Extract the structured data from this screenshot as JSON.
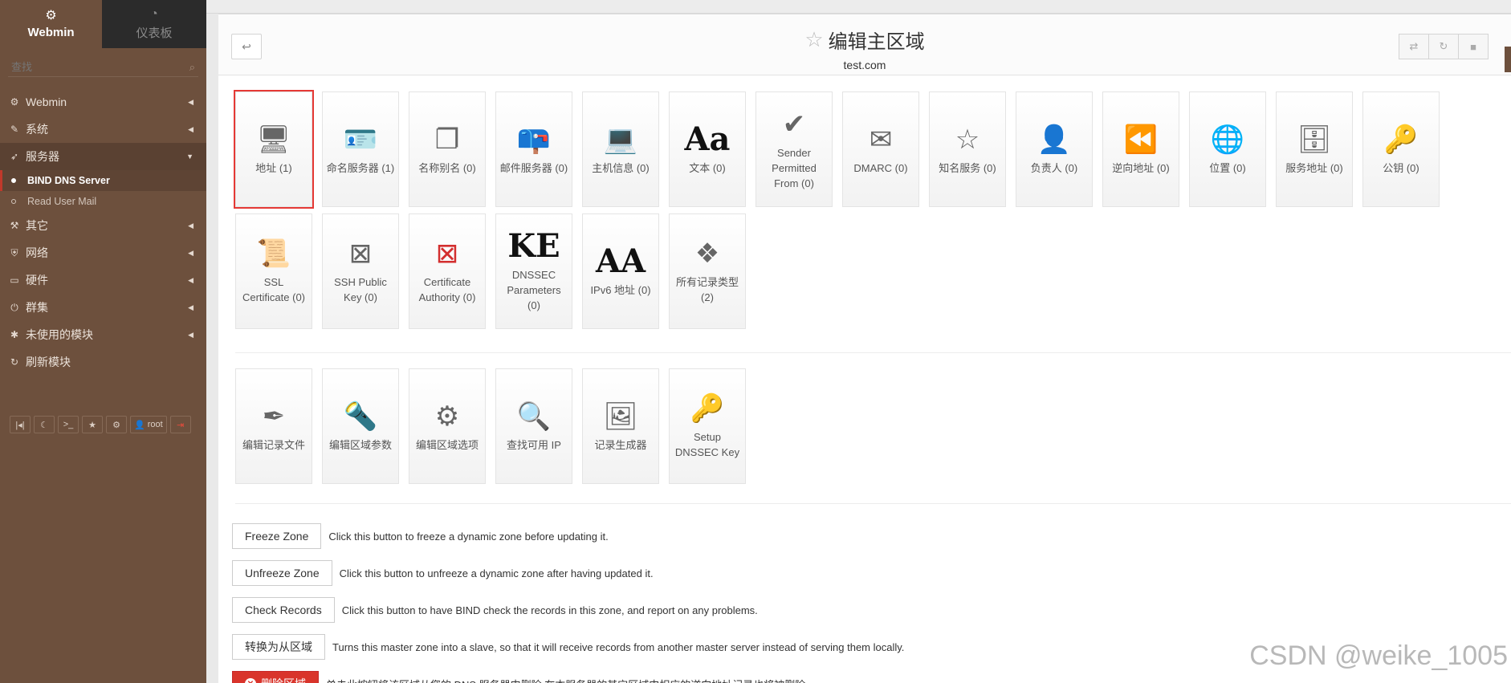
{
  "sidebar": {
    "brand_label": "Webmin",
    "dashboard_label": "仪表板",
    "search_placeholder": "查找",
    "items": [
      {
        "label": "Webmin",
        "icon": "gear-icon"
      },
      {
        "label": "系统",
        "icon": "wrench-icon"
      },
      {
        "label": "服务器",
        "icon": "rocket-icon"
      },
      {
        "label": "其它",
        "icon": "hammer-icon"
      },
      {
        "label": "网络",
        "icon": "shield-icon"
      },
      {
        "label": "硬件",
        "icon": "hdd-icon"
      },
      {
        "label": "群集",
        "icon": "power-icon"
      },
      {
        "label": "未使用的模块",
        "icon": "puzzle-icon"
      },
      {
        "label": "刷新模块",
        "icon": "refresh-icon"
      }
    ],
    "subitems": [
      {
        "label": "BIND DNS Server"
      },
      {
        "label": "Read User Mail"
      }
    ],
    "toolbar_user": "root"
  },
  "header": {
    "title": "编辑主区域",
    "subtitle": "test.com"
  },
  "records": [
    {
      "label": "地址 (1)",
      "icon": "computer-icon"
    },
    {
      "label": "命名服务器 (1)",
      "icon": "nameserver-card-icon"
    },
    {
      "label": "名称别名 (0)",
      "icon": "alias-windows-icon"
    },
    {
      "label": "邮件服务器 (0)",
      "icon": "mailbox-icon"
    },
    {
      "label": "主机信息 (0)",
      "icon": "laptop-icon"
    },
    {
      "label": "文本 (0)",
      "icon": "text-icon",
      "glyph": "Aa"
    },
    {
      "label": "Sender Permitted From (0)",
      "icon": "checkmark-tools-icon"
    },
    {
      "label": "DMARC (0)",
      "icon": "dmarc-card-icon"
    },
    {
      "label": "知名服务 (0)",
      "icon": "star-icon"
    },
    {
      "label": "负责人 (0)",
      "icon": "person-icon"
    },
    {
      "label": "逆向地址 (0)",
      "icon": "rewind-icon"
    },
    {
      "label": "位置 (0)",
      "icon": "globe-icon"
    },
    {
      "label": "服务地址 (0)",
      "icon": "server-icon"
    },
    {
      "label": "公钥 (0)",
      "icon": "key-icon"
    },
    {
      "label": "SSL Certificate (0)",
      "icon": "certificate-text-icon"
    },
    {
      "label": "SSH Public Key (0)",
      "icon": "image-not-found-icon"
    },
    {
      "label": "Certificate Authority (0)",
      "icon": "image-not-found-icon"
    },
    {
      "label": "DNSSEC Parameters (0)",
      "icon": "dnssec-icon",
      "glyph": "KE"
    },
    {
      "label": "IPv6 地址 (0)",
      "icon": "ipv6-icon",
      "glyph": "AA"
    },
    {
      "label": "所有记录类型 (2)",
      "icon": "cubes-icon"
    }
  ],
  "tools": [
    {
      "label": "编辑记录文件",
      "icon": "quill-icon"
    },
    {
      "label": "编辑区域参数",
      "icon": "lamp-icon"
    },
    {
      "label": "编辑区域选项",
      "icon": "gear-icon"
    },
    {
      "label": "查找可用 IP",
      "icon": "magnifier-icon"
    },
    {
      "label": "记录生成器",
      "icon": "generator-screen-icon"
    },
    {
      "label": "Setup DNSSEC Key",
      "icon": "key-icon"
    }
  ],
  "actions": [
    {
      "button": "Freeze Zone",
      "desc": "Click this button to freeze a dynamic zone before updating it."
    },
    {
      "button": "Unfreeze Zone",
      "desc": "Click this button to unfreeze a dynamic zone after having updated it."
    },
    {
      "button": "Check Records",
      "desc": "Click this button to have BIND check the records in this zone, and report on any problems."
    },
    {
      "button": "转换为从区域",
      "desc": "Turns this master zone into a slave, so that it will receive records from another master server instead of serving them locally."
    },
    {
      "button": "删除区域",
      "desc": "单击此按钮将该区域从您的 DNS 服务器中删除.在本服务器的其它区域中相应的逆向地址记录也将被删除."
    }
  ],
  "watermark": "CSDN @weike_1005",
  "colors": {
    "sidebar": "#6d503d",
    "accent": "#d9342b",
    "selected_outline": "#e53935"
  }
}
